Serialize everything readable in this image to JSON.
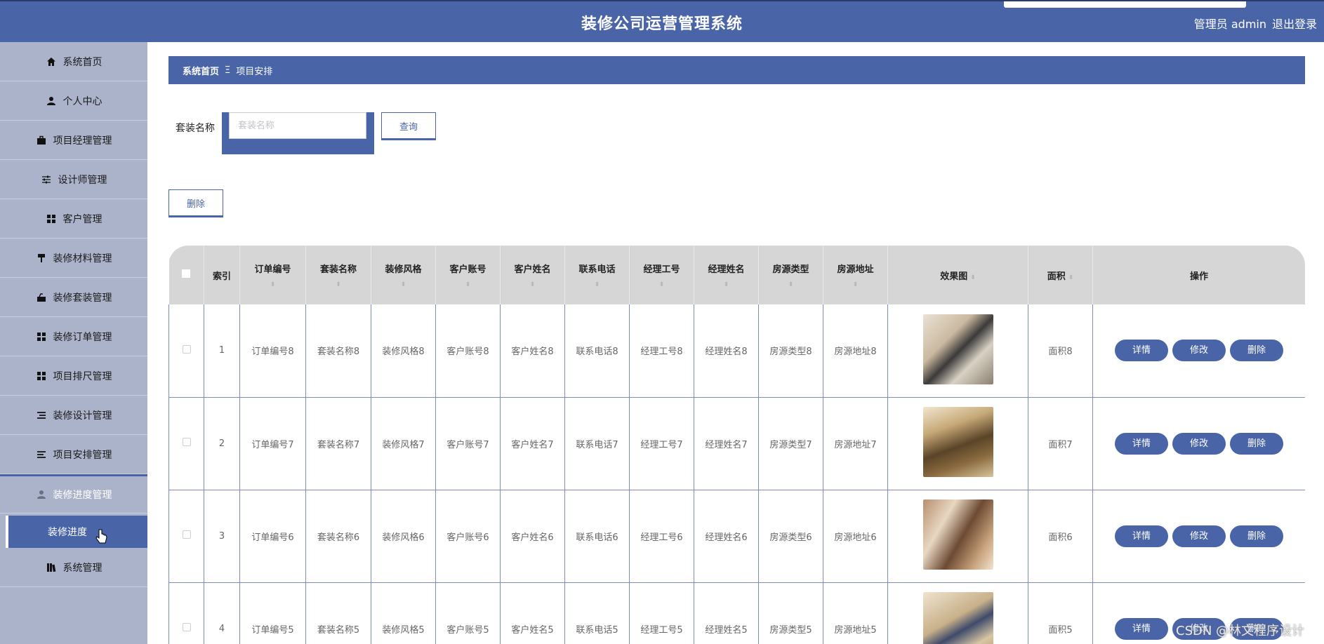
{
  "app": {
    "title": "装修公司运营管理系统",
    "user": "管理员 admin",
    "logout": "退出登录"
  },
  "sidebar": {
    "items": [
      {
        "label": "系统首页",
        "icon": "home-icon"
      },
      {
        "label": "个人中心",
        "icon": "user-icon"
      },
      {
        "label": "项目经理管理",
        "icon": "briefcase-icon"
      },
      {
        "label": "设计师管理",
        "icon": "sliders-icon"
      },
      {
        "label": "客户管理",
        "icon": "grid-icon"
      },
      {
        "label": "装修材料管理",
        "icon": "paint-roller-icon"
      },
      {
        "label": "装修套装管理",
        "icon": "toolbox-icon"
      },
      {
        "label": "装修订单管理",
        "icon": "grid-icon"
      },
      {
        "label": "项目排尺管理",
        "icon": "grid-icon"
      },
      {
        "label": "装修设计管理",
        "icon": "list-icon"
      },
      {
        "label": "项目安排管理",
        "icon": "align-icon"
      },
      {
        "label": "装修进度管理",
        "icon": "user-icon"
      }
    ],
    "sub_item": "装修进度",
    "last_item": {
      "label": "系统管理",
      "icon": "books-icon"
    }
  },
  "breadcrumb": {
    "home": "系统首页",
    "separator": "Ξ",
    "current": "项目安排"
  },
  "search": {
    "label": "套装名称",
    "placeholder": "套装名称",
    "value": "",
    "button": "查询"
  },
  "toolbar": {
    "delete_label": "删除"
  },
  "table": {
    "headers": [
      "索引",
      "订单编号",
      "套装名称",
      "装修风格",
      "客户账号",
      "客户姓名",
      "联系电话",
      "经理工号",
      "经理姓名",
      "房源类型",
      "房源地址",
      "效果图",
      "面积",
      "操作"
    ],
    "rows": [
      {
        "index": "1",
        "cells": [
          "订单编号8",
          "套装名称8",
          "装修风格8",
          "客户账号8",
          "客户姓名8",
          "联系电话8",
          "经理工号8",
          "经理姓名8",
          "房源类型8",
          "房源地址8"
        ],
        "area": "面积8"
      },
      {
        "index": "2",
        "cells": [
          "订单编号7",
          "套装名称7",
          "装修风格7",
          "客户账号7",
          "客户姓名7",
          "联系电话7",
          "经理工号7",
          "经理姓名7",
          "房源类型7",
          "房源地址7"
        ],
        "area": "面积7"
      },
      {
        "index": "3",
        "cells": [
          "订单编号6",
          "套装名称6",
          "装修风格6",
          "客户账号6",
          "客户姓名6",
          "联系电话6",
          "经理工号6",
          "经理姓名6",
          "房源类型6",
          "房源地址6"
        ],
        "area": "面积6"
      },
      {
        "index": "4",
        "cells": [
          "订单编号5",
          "套装名称5",
          "装修风格5",
          "客户账号5",
          "客户姓名5",
          "联系电话5",
          "经理工号5",
          "经理姓名5",
          "房源类型5",
          "房源地址5"
        ],
        "area": "面积5"
      }
    ],
    "actions": {
      "detail": "详情",
      "edit": "修改",
      "delete": "删除"
    }
  },
  "watermark": "CSDN @林文程序设计",
  "colors": {
    "primary": "#4a64a8",
    "sidebar": "#abb3ca",
    "header_row": "#d6d6d6"
  }
}
